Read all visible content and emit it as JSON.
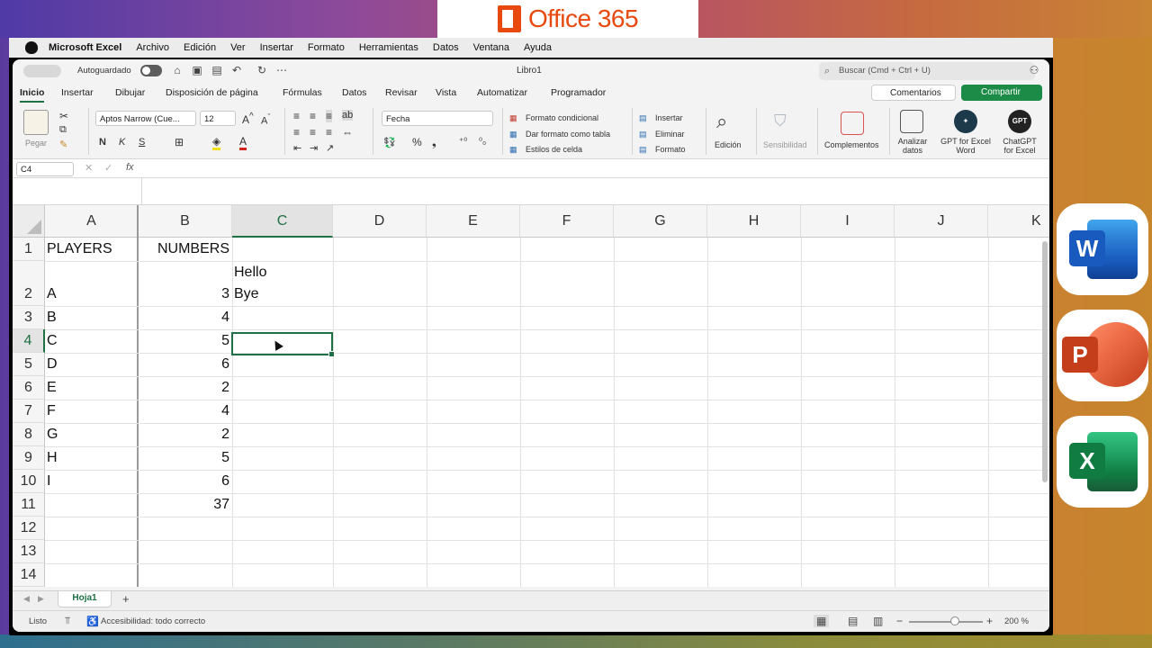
{
  "banner": {
    "text": "Office 365",
    "color": "#e8490e"
  },
  "mac_menu": {
    "app": "Microsoft Excel",
    "items": [
      "Archivo",
      "Edición",
      "Ver",
      "Insertar",
      "Formato",
      "Herramientas",
      "Datos",
      "Ventana",
      "Ayuda"
    ]
  },
  "titlebar": {
    "autosave_label": "Autoguardado",
    "doc_title": "Libro1",
    "search_placeholder": "Buscar (Cmd + Ctrl + U)"
  },
  "ribbon_tabs": [
    "Inicio",
    "Insertar",
    "Dibujar",
    "Disposición de página",
    "Fórmulas",
    "Datos",
    "Revisar",
    "Vista",
    "Automatizar",
    "Programador"
  ],
  "active_tab": "Inicio",
  "actions": {
    "comments": "Comentarios",
    "share": "Compartir"
  },
  "ribbon": {
    "paste": "Pegar",
    "font_name": "Aptos Narrow (Cue...",
    "font_size": "12",
    "bold": "N",
    "italic": "K",
    "underline": "S",
    "number_format": "Fecha",
    "conditional": "Formato condicional",
    "as_table": "Dar formato como tabla",
    "cell_styles": "Estilos de celda",
    "insert": "Insertar",
    "delete": "Eliminar",
    "format": "Formato",
    "editing": "Edición",
    "sensitivity": "Sensibilidad",
    "addins": "Complementos",
    "analyze": "Analizar datos",
    "gpt_word": "GPT for Excel Word",
    "chatgpt": "ChatGPT for Excel",
    "gpt_badge": "GPT"
  },
  "formula_bar": {
    "name_box": "C4",
    "fx": "fx",
    "value": ""
  },
  "columns": [
    "A",
    "B",
    "C",
    "D",
    "E",
    "F",
    "G",
    "H",
    "I",
    "J",
    "K"
  ],
  "selected_column": "C",
  "rows": [
    {
      "n": "1",
      "a": "PLAYERS",
      "b": "NUMBERS",
      "c": ""
    },
    {
      "n": "2",
      "a": "A",
      "b": "3",
      "c": "Hello\nBye"
    },
    {
      "n": "3",
      "a": "B",
      "b": "4",
      "c": ""
    },
    {
      "n": "4",
      "a": "C",
      "b": "5",
      "c": ""
    },
    {
      "n": "5",
      "a": "D",
      "b": "6",
      "c": ""
    },
    {
      "n": "6",
      "a": "E",
      "b": "2",
      "c": ""
    },
    {
      "n": "7",
      "a": "F",
      "b": "4",
      "c": ""
    },
    {
      "n": "8",
      "a": "G",
      "b": "2",
      "c": ""
    },
    {
      "n": "9",
      "a": "H",
      "b": "5",
      "c": ""
    },
    {
      "n": "10",
      "a": "I",
      "b": "6",
      "c": ""
    },
    {
      "n": "11",
      "a": "",
      "b": "37",
      "c": ""
    },
    {
      "n": "12",
      "a": "",
      "b": "",
      "c": ""
    },
    {
      "n": "13",
      "a": "",
      "b": "",
      "c": ""
    },
    {
      "n": "14",
      "a": "",
      "b": "",
      "c": ""
    }
  ],
  "c2_line1": "Hello",
  "c2_line2": "Bye",
  "active_cell": "C4",
  "sheet_tab": "Hoja1",
  "status": {
    "ready": "Listo",
    "accessibility": "Accesibilidad: todo correcto",
    "zoom": "200 %"
  },
  "side_apps": [
    {
      "name": "Word",
      "letter": "W",
      "color": "#185abd"
    },
    {
      "name": "PowerPoint",
      "letter": "P",
      "color": "#c43e1c"
    },
    {
      "name": "Excel",
      "letter": "X",
      "color": "#107c41"
    }
  ]
}
